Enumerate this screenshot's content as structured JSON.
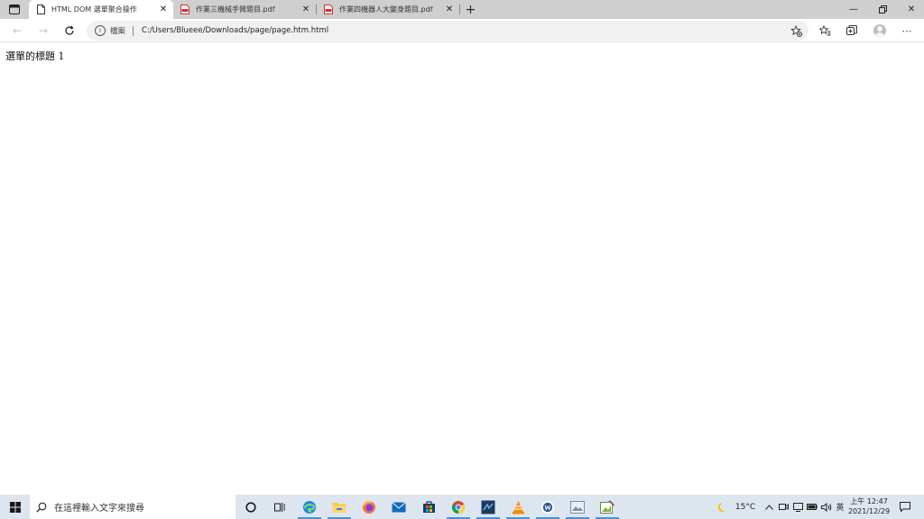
{
  "browser": {
    "tabs": [
      {
        "title": "HTML DOM 選單聚合操作",
        "active": true,
        "icon": "document-icon"
      },
      {
        "title": "作業三機械手臂題目.pdf",
        "active": false,
        "icon": "pdf-icon"
      },
      {
        "title": "作業四機器人大變身題目.pdf",
        "active": false,
        "icon": "pdf-icon"
      }
    ],
    "new_tab_glyph": "+",
    "address": {
      "security_label": "檔案",
      "url": "C:/Users/Blueee/Downloads/page/page.htm.html"
    },
    "accent": "#0078d4"
  },
  "page": {
    "text": "選單的標題 1"
  },
  "taskbar": {
    "search_placeholder": "在這裡輸入文字來搜尋",
    "pinned": [
      "cortana-icon",
      "task-view-icon",
      "edge-icon",
      "file-explorer-icon",
      "firefox-icon",
      "mail-icon",
      "store-icon",
      "chrome-icon",
      "code-editor-icon",
      "vlc-icon",
      "word-icon",
      "photos-icon",
      "paint-icon"
    ],
    "weather": {
      "temp": "15°C",
      "icon": "moon-icon"
    },
    "ime": "英",
    "time": "上午 12:47",
    "date": "2021/12/29"
  }
}
